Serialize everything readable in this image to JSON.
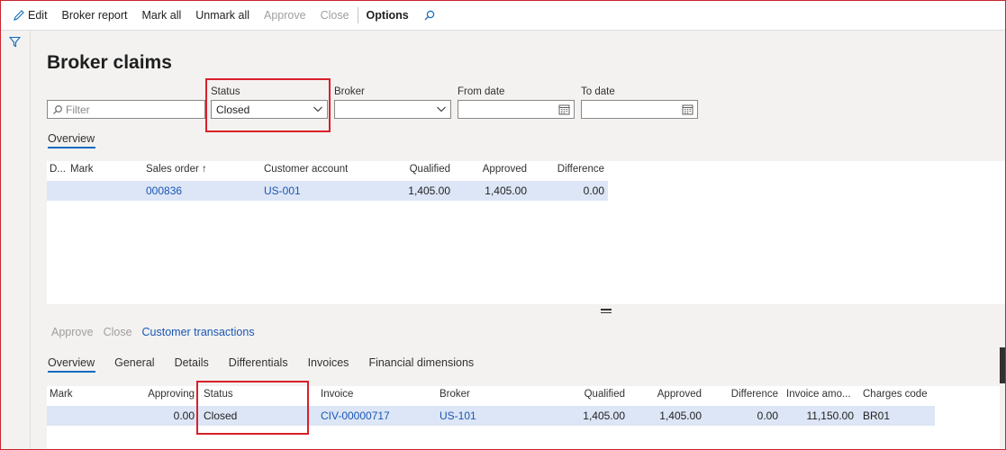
{
  "toolbar": {
    "edit": "Edit",
    "broker_report": "Broker report",
    "mark_all": "Mark all",
    "unmark_all": "Unmark all",
    "approve": "Approve",
    "close": "Close",
    "options": "Options"
  },
  "page": {
    "title": "Broker claims"
  },
  "filters": {
    "filter_placeholder": "Filter",
    "status_label": "Status",
    "status_value": "Closed",
    "broker_label": "Broker",
    "broker_value": "",
    "from_date_label": "From date",
    "from_date_value": "",
    "to_date_label": "To date",
    "to_date_value": ""
  },
  "upper_tabs": [
    "Overview"
  ],
  "upper_grid": {
    "headers": {
      "d": "D...",
      "mark": "Mark",
      "sales_order": "Sales order",
      "customer_account": "Customer account",
      "qualified": "Qualified",
      "approved": "Approved",
      "difference": "Difference"
    },
    "sort_glyph": "↑",
    "rows": [
      {
        "sales_order": "000836",
        "customer_account": "US-001",
        "qualified": "1,405.00",
        "approved": "1,405.00",
        "difference": "0.00"
      }
    ]
  },
  "lower_actions": {
    "approve": "Approve",
    "close": "Close",
    "customer_transactions": "Customer transactions"
  },
  "lower_tabs": [
    "Overview",
    "General",
    "Details",
    "Differentials",
    "Invoices",
    "Financial dimensions"
  ],
  "lower_grid": {
    "headers": {
      "mark": "Mark",
      "approving": "Approving",
      "status": "Status",
      "invoice": "Invoice",
      "broker": "Broker",
      "qualified": "Qualified",
      "approved": "Approved",
      "difference": "Difference",
      "invoice_amount": "Invoice amo...",
      "charges_code": "Charges code"
    },
    "rows": [
      {
        "approving": "0.00",
        "status": "Closed",
        "invoice": "CIV-00000717",
        "broker": "US-101",
        "qualified": "1,405.00",
        "approved": "1,405.00",
        "difference": "0.00",
        "invoice_amount": "11,150.00",
        "charges_code": "BR01"
      }
    ]
  },
  "colors": {
    "accent": "#0f6cbd",
    "link": "#1a56b4",
    "selected_row": "#dde6f6",
    "highlight": "#d9202a"
  }
}
